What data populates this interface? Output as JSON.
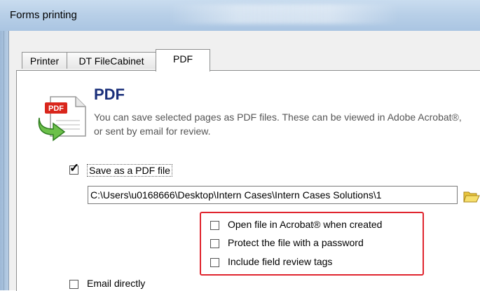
{
  "window": {
    "title": "Forms printing"
  },
  "tabs": [
    {
      "label": "Printer"
    },
    {
      "label": "DT FileCabinet"
    },
    {
      "label": "PDF",
      "selected": true
    }
  ],
  "pdf_section": {
    "title": "PDF",
    "description": "You can save selected pages as PDF files. These can be viewed in Adobe Acrobat®, or sent by email for review.",
    "logo_text": "PDF"
  },
  "options": {
    "save_pdf": {
      "label": "Save as a PDF file",
      "checked": true,
      "check_glyph": "✓"
    },
    "path": {
      "value": "C:\\Users\\u0168666\\Desktop\\Intern Cases\\Intern Cases Solutions\\1"
    },
    "open_in_acrobat": {
      "label": "Open file in Acrobat® when created",
      "checked": false
    },
    "protect_password": {
      "label": "Protect the file with a password",
      "checked": false
    },
    "review_tags": {
      "label": "Include field review tags",
      "checked": false
    },
    "email_directly": {
      "label": "Email directly",
      "checked": false
    }
  },
  "colors": {
    "highlight": "#e0252e",
    "title_blue": "#1a2f7a",
    "titlebar": "#b9d0e8"
  },
  "icons": {
    "logo": "pdf-arrow-icon",
    "folder": "folder-open-icon"
  }
}
